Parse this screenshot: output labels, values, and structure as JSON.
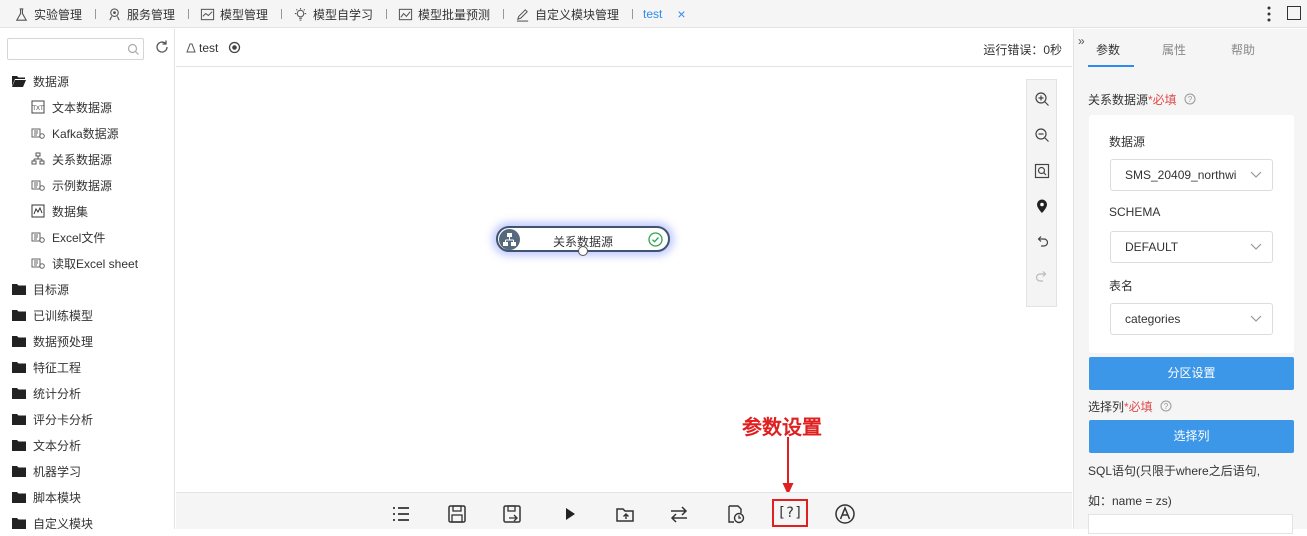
{
  "top_tabs": [
    {
      "label": "实验管理",
      "icon": "flask-icon"
    },
    {
      "label": "服务管理",
      "icon": "service-icon"
    },
    {
      "label": "模型管理",
      "icon": "chart-line-icon"
    },
    {
      "label": "模型自学习",
      "icon": "lightbulb-icon"
    },
    {
      "label": "模型批量预测",
      "icon": "chart-area-icon"
    },
    {
      "label": "自定义模块管理",
      "icon": "pencil-doc-icon"
    },
    {
      "label": "test",
      "icon": "",
      "close": "×"
    }
  ],
  "left_panel": {
    "search_placeholder": "",
    "tree": [
      {
        "label": "数据源",
        "type": "folder",
        "open": true
      },
      {
        "label": "文本数据源",
        "type": "leaf",
        "icon": "txt-file-icon"
      },
      {
        "label": "Kafka数据源",
        "type": "leaf",
        "icon": "source-icon"
      },
      {
        "label": "关系数据源",
        "type": "leaf",
        "icon": "relation-icon"
      },
      {
        "label": "示例数据源",
        "type": "leaf",
        "icon": "source-icon"
      },
      {
        "label": "数据集",
        "type": "leaf",
        "icon": "dataset-icon"
      },
      {
        "label": "Excel文件",
        "type": "leaf",
        "icon": "source-icon"
      },
      {
        "label": "读取Excel sheet",
        "type": "leaf",
        "icon": "source-icon"
      },
      {
        "label": "目标源",
        "type": "folder"
      },
      {
        "label": "已训练模型",
        "type": "folder"
      },
      {
        "label": "数据预处理",
        "type": "folder"
      },
      {
        "label": "特征工程",
        "type": "folder"
      },
      {
        "label": "统计分析",
        "type": "folder"
      },
      {
        "label": "评分卡分析",
        "type": "folder"
      },
      {
        "label": "文本分析",
        "type": "folder"
      },
      {
        "label": "机器学习",
        "type": "folder"
      },
      {
        "label": "脚本模块",
        "type": "folder"
      },
      {
        "label": "自定义模块",
        "type": "folder"
      }
    ]
  },
  "canvas": {
    "experiment_name": "test",
    "run_error": "运行错误：0秒",
    "node_label": "关系数据源",
    "annotation": "参数设置",
    "annotation_color": "#e02020"
  },
  "bottom_toolbar": {
    "icons": [
      "list-icon",
      "save-icon",
      "save-as-icon",
      "run-icon",
      "export-icon",
      "swap-icon",
      "schedule-icon",
      "param-settings-icon",
      "auto-icon"
    ],
    "param_label": "[?]"
  },
  "right_panel": {
    "tabs": [
      "参数",
      "属性",
      "帮助"
    ],
    "section_title": "关系数据源",
    "required": "*必填",
    "datasource_label": "数据源",
    "datasource_value": "SMS_20409_northwi",
    "schema_label": "SCHEMA",
    "schema_value": "DEFAULT",
    "table_label": "表名",
    "table_value": "categories",
    "partition_button": "分区设置",
    "select_col_label": "选择列",
    "select_col_button": "选择列",
    "sql_hint_1": "SQL语句(只限于where之后语句,",
    "sql_hint_2": "如：name = zs)"
  },
  "colors": {
    "accent": "#2d8cf0",
    "button_blue": "#3c97e8",
    "node_border": "#40556d",
    "success_green": "#2ea44f"
  }
}
